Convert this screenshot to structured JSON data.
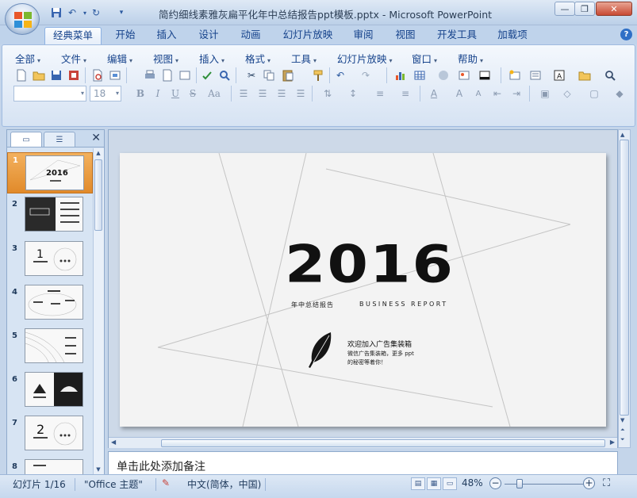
{
  "window": {
    "title": "简约细线素雅灰扁平化年中总结报告ppt模板.pptx - Microsoft PowerPoint",
    "minimize": "—",
    "restore": "❐",
    "close": "✕"
  },
  "quick_access": [
    "save-icon",
    "undo-icon",
    "redo-icon",
    "customize-icon"
  ],
  "tabs": [
    {
      "label": "经典菜单",
      "active": true
    },
    {
      "label": "开始"
    },
    {
      "label": "插入"
    },
    {
      "label": "设计"
    },
    {
      "label": "动画"
    },
    {
      "label": "幻灯片放映"
    },
    {
      "label": "审阅"
    },
    {
      "label": "视图"
    },
    {
      "label": "开发工具"
    },
    {
      "label": "加载项"
    }
  ],
  "menu": [
    "全部",
    "文件",
    "编辑",
    "视图",
    "插入",
    "格式",
    "工具",
    "幻灯片放映",
    "窗口",
    "帮助"
  ],
  "format_bar": {
    "font_name": "",
    "font_size": "18"
  },
  "slide_panel": {
    "thumbnails": [
      {
        "num": "1",
        "selected": true
      },
      {
        "num": "2"
      },
      {
        "num": "3"
      },
      {
        "num": "4"
      },
      {
        "num": "5"
      },
      {
        "num": "6"
      },
      {
        "num": "7"
      },
      {
        "num": "8"
      }
    ]
  },
  "slide": {
    "year": "2016",
    "subtitle_cn": "年中总结报告",
    "subtitle_en": "BUSINESS REPORT",
    "ad_title": "欢迎加入广告集装箱",
    "ad_line1": "微信广告集装箱，更多 ppt",
    "ad_line2": "的秘密等着你！"
  },
  "notes": {
    "placeholder": "单击此处添加备注"
  },
  "status": {
    "slide_count": "幻灯片 1/16",
    "theme": "\"Office 主题\"",
    "language": "中文(简体，中国)",
    "zoom": "48%"
  },
  "colors": {
    "ribbon_blue": "#15428b",
    "selected_thumb": "#e18a2a"
  }
}
